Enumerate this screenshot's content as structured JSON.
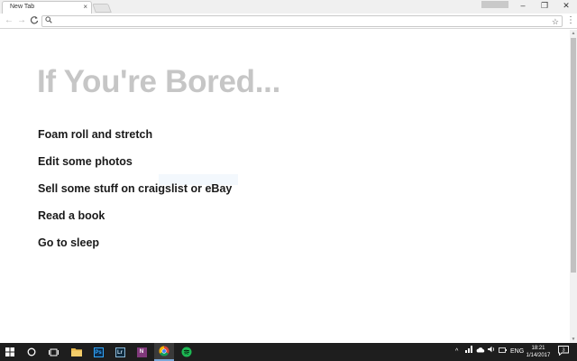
{
  "browser": {
    "tab_title": "New Tab",
    "tab_close": "×",
    "profile_badge": "",
    "window_controls": {
      "minimize": "–",
      "restore": "❐",
      "close": "✕"
    },
    "nav": {
      "back": "←",
      "forward": "→",
      "reload": "C"
    },
    "omnibox": {
      "value": "",
      "search_glyph": "⚲",
      "star_glyph": "☆"
    },
    "menu_glyph": "⋮"
  },
  "page": {
    "headline": "If You're Bored...",
    "items": [
      "Foam roll and stretch",
      "Edit some photos",
      "Sell some stuff on craigslist or eBay",
      "Read a book",
      "Go to sleep"
    ]
  },
  "taskbar": {
    "start_glyph": "⊞",
    "search_glyph": "○",
    "taskview_glyph": "▭",
    "apps": [
      {
        "name": "file-explorer",
        "label": ""
      },
      {
        "name": "photoshop",
        "label": "Ps"
      },
      {
        "name": "lightroom",
        "label": "Lr"
      },
      {
        "name": "onenote",
        "label": "N"
      },
      {
        "name": "chrome",
        "label": ""
      },
      {
        "name": "spotify",
        "label": ""
      }
    ],
    "tray": {
      "chevron": "^",
      "language": "ENG"
    },
    "clock": {
      "time": "18:21",
      "date": "1/14/2017"
    },
    "notification_count": "3"
  },
  "colors": {
    "headline": "#c6c6c6",
    "item_text": "#1a1a1a",
    "taskbar": "#1e1e1e",
    "photoshop": "#0b2a48",
    "lightroom": "#0e2a3e",
    "onenote": "#80397b",
    "spotify": "#1db954",
    "explorer": "#e8b84a"
  }
}
